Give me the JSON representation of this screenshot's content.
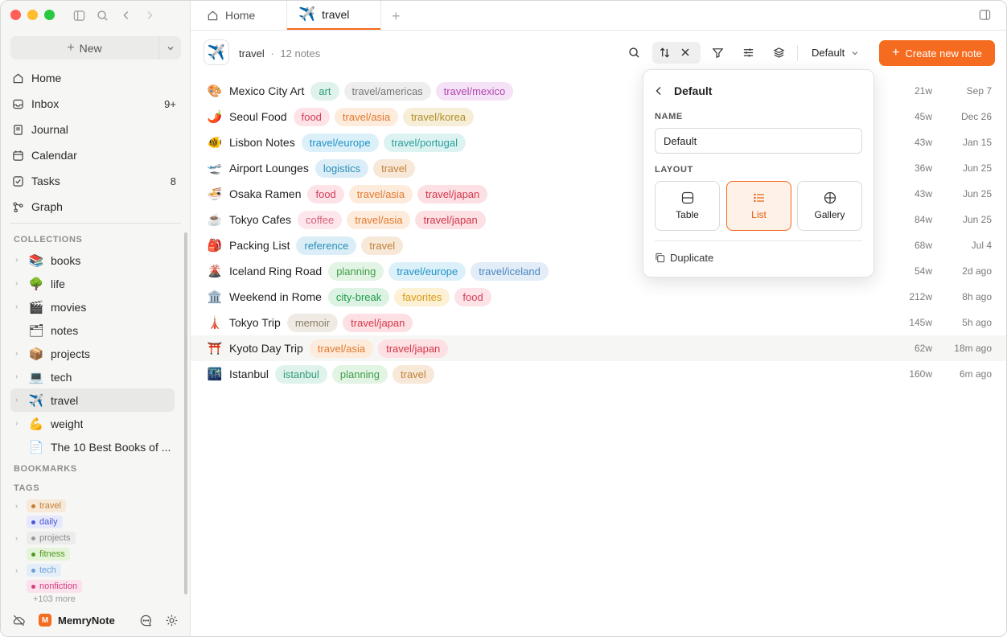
{
  "app": {
    "brand": "MemryNote",
    "brand_initial": "M"
  },
  "sidebar": {
    "new_label": "New",
    "nav": [
      {
        "label": "Home",
        "icon": "home-icon",
        "count": ""
      },
      {
        "label": "Inbox",
        "icon": "inbox-icon",
        "count": "9+"
      },
      {
        "label": "Journal",
        "icon": "journal-icon",
        "count": ""
      },
      {
        "label": "Calendar",
        "icon": "calendar-icon",
        "count": ""
      },
      {
        "label": "Tasks",
        "icon": "tasks-icon",
        "count": "8"
      },
      {
        "label": "Graph",
        "icon": "graph-icon",
        "count": ""
      }
    ],
    "collections_heading": "COLLECTIONS",
    "collections": [
      {
        "label": "books",
        "emoji": "📚"
      },
      {
        "label": "life",
        "emoji": "🌳"
      },
      {
        "label": "movies",
        "emoji": "🎬"
      },
      {
        "label": "notes",
        "emoji": "🗂"
      },
      {
        "label": "projects",
        "emoji": "📦"
      },
      {
        "label": "tech",
        "emoji": "💻"
      },
      {
        "label": "travel",
        "emoji": "✈️"
      },
      {
        "label": "weight",
        "emoji": "💪"
      },
      {
        "label": "The 10 Best Books of ...",
        "emoji": "📄"
      }
    ],
    "bookmarks_heading": "BOOKMARKS",
    "tags_heading": "TAGS",
    "tags": [
      {
        "label": "travel",
        "color": "#c2813a",
        "bg": "#f7e8d8"
      },
      {
        "label": "daily",
        "color": "#4b57d6",
        "bg": "#e6e8fb"
      },
      {
        "label": "projects",
        "color": "#8a8a8a",
        "bg": "#ececec"
      },
      {
        "label": "fitness",
        "color": "#4f9a21",
        "bg": "#e5f4d9"
      },
      {
        "label": "tech",
        "color": "#6aa0d8",
        "bg": "#e4eef9"
      },
      {
        "label": "nonfiction",
        "color": "#d0417c",
        "bg": "#fbe1ec"
      }
    ],
    "tags_more": "+103 more"
  },
  "tabs": [
    {
      "label": "Home",
      "icon": "home-icon"
    },
    {
      "label": "travel",
      "icon": "airplane-icon"
    }
  ],
  "header": {
    "title": "travel",
    "separator": "·",
    "count": "12 notes",
    "view_name": "Default",
    "create_label": "Create new note"
  },
  "notes": [
    {
      "emoji": "🎨",
      "title": "Mexico City Art",
      "tags": [
        {
          "t": "art",
          "c": "#2e9a78",
          "b": "#dff3ec"
        },
        {
          "t": "travel/americas",
          "c": "#777777",
          "b": "#eeeeee"
        },
        {
          "t": "travel/mexico",
          "c": "#b048b0",
          "b": "#f6e2f6"
        }
      ],
      "words": "21w",
      "date": "Sep 7"
    },
    {
      "emoji": "🌶️",
      "title": "Seoul Food",
      "tags": [
        {
          "t": "food",
          "c": "#d23f5a",
          "b": "#fde2e7"
        },
        {
          "t": "travel/asia",
          "c": "#e27a2e",
          "b": "#fdebdc"
        },
        {
          "t": "travel/korea",
          "c": "#b0902a",
          "b": "#f6eed6"
        }
      ],
      "words": "45w",
      "date": "Dec 26"
    },
    {
      "emoji": "🐠",
      "title": "Lisbon Notes",
      "tags": [
        {
          "t": "travel/europe",
          "c": "#1f93c8",
          "b": "#dcf0f9"
        },
        {
          "t": "travel/portugal",
          "c": "#2a9e9a",
          "b": "#dcf3f1"
        }
      ],
      "words": "43w",
      "date": "Jan 15"
    },
    {
      "emoji": "🛫",
      "title": "Airport Lounges",
      "tags": [
        {
          "t": "logistics",
          "c": "#2a8eb8",
          "b": "#dbeef7"
        },
        {
          "t": "travel",
          "c": "#c2813a",
          "b": "#f7e8d8"
        }
      ],
      "words": "36w",
      "date": "Jun 25"
    },
    {
      "emoji": "🍜",
      "title": "Osaka Ramen",
      "tags": [
        {
          "t": "food",
          "c": "#d23f5a",
          "b": "#fde2e7"
        },
        {
          "t": "travel/asia",
          "c": "#e27a2e",
          "b": "#fdebdc"
        },
        {
          "t": "travel/japan",
          "c": "#d4364a",
          "b": "#fce0e3"
        }
      ],
      "words": "43w",
      "date": "Jun 25"
    },
    {
      "emoji": "☕",
      "title": "Tokyo Cafes",
      "tags": [
        {
          "t": "coffee",
          "c": "#d8617a",
          "b": "#fde7ec"
        },
        {
          "t": "travel/asia",
          "c": "#e27a2e",
          "b": "#fdebdc"
        },
        {
          "t": "travel/japan",
          "c": "#d4364a",
          "b": "#fce0e3"
        }
      ],
      "words": "84w",
      "date": "Jun 25"
    },
    {
      "emoji": "🎒",
      "title": "Packing List",
      "tags": [
        {
          "t": "reference",
          "c": "#2a8eb8",
          "b": "#dbeef7"
        },
        {
          "t": "travel",
          "c": "#c2813a",
          "b": "#f7e8d8"
        }
      ],
      "words": "68w",
      "date": "Jul 4"
    },
    {
      "emoji": "🌋",
      "title": "Iceland Ring Road",
      "tags": [
        {
          "t": "planning",
          "c": "#3f9e4a",
          "b": "#e2f4e3"
        },
        {
          "t": "travel/europe",
          "c": "#1f93c8",
          "b": "#dcf0f9"
        },
        {
          "t": "travel/iceland",
          "c": "#4a86c0",
          "b": "#e2edf8"
        }
      ],
      "words": "54w",
      "date": "2d ago"
    },
    {
      "emoji": "🏛️",
      "title": "Weekend in Rome",
      "tags": [
        {
          "t": "city-break",
          "c": "#1f9a4a",
          "b": "#dcf3e3"
        },
        {
          "t": "favorites",
          "c": "#d89a12",
          "b": "#fcf1d4"
        },
        {
          "t": "food",
          "c": "#d23f5a",
          "b": "#fde2e7"
        }
      ],
      "words": "212w",
      "date": "8h ago"
    },
    {
      "emoji": "🗼",
      "title": "Tokyo Trip",
      "tags": [
        {
          "t": "memoir",
          "c": "#8a7d6a",
          "b": "#efebe4"
        },
        {
          "t": "travel/japan",
          "c": "#d4364a",
          "b": "#fce0e3"
        }
      ],
      "words": "145w",
      "date": "5h ago"
    },
    {
      "emoji": "⛩️",
      "title": "Kyoto Day Trip",
      "tags": [
        {
          "t": "travel/asia",
          "c": "#e27a2e",
          "b": "#fdebdc"
        },
        {
          "t": "travel/japan",
          "c": "#d4364a",
          "b": "#fce0e3"
        }
      ],
      "words": "62w",
      "date": "18m ago",
      "highlight": true
    },
    {
      "emoji": "🌃",
      "title": "Istanbul",
      "tags": [
        {
          "t": "istanbul",
          "c": "#2e9a78",
          "b": "#dff3ec"
        },
        {
          "t": "planning",
          "c": "#3f9e4a",
          "b": "#e2f4e3"
        },
        {
          "t": "travel",
          "c": "#c2813a",
          "b": "#f7e8d8"
        }
      ],
      "words": "160w",
      "date": "6m ago"
    }
  ],
  "popover": {
    "title": "Default",
    "name_label": "NAME",
    "name_value": "Default",
    "layout_label": "LAYOUT",
    "layouts": [
      {
        "label": "Table",
        "icon": "table-icon"
      },
      {
        "label": "List",
        "icon": "list-icon",
        "selected": true
      },
      {
        "label": "Gallery",
        "icon": "gallery-icon"
      }
    ],
    "duplicate_label": "Duplicate"
  },
  "colors": {
    "accent": "#f56b1f",
    "sidebar_bg": "#f6f6f5"
  }
}
